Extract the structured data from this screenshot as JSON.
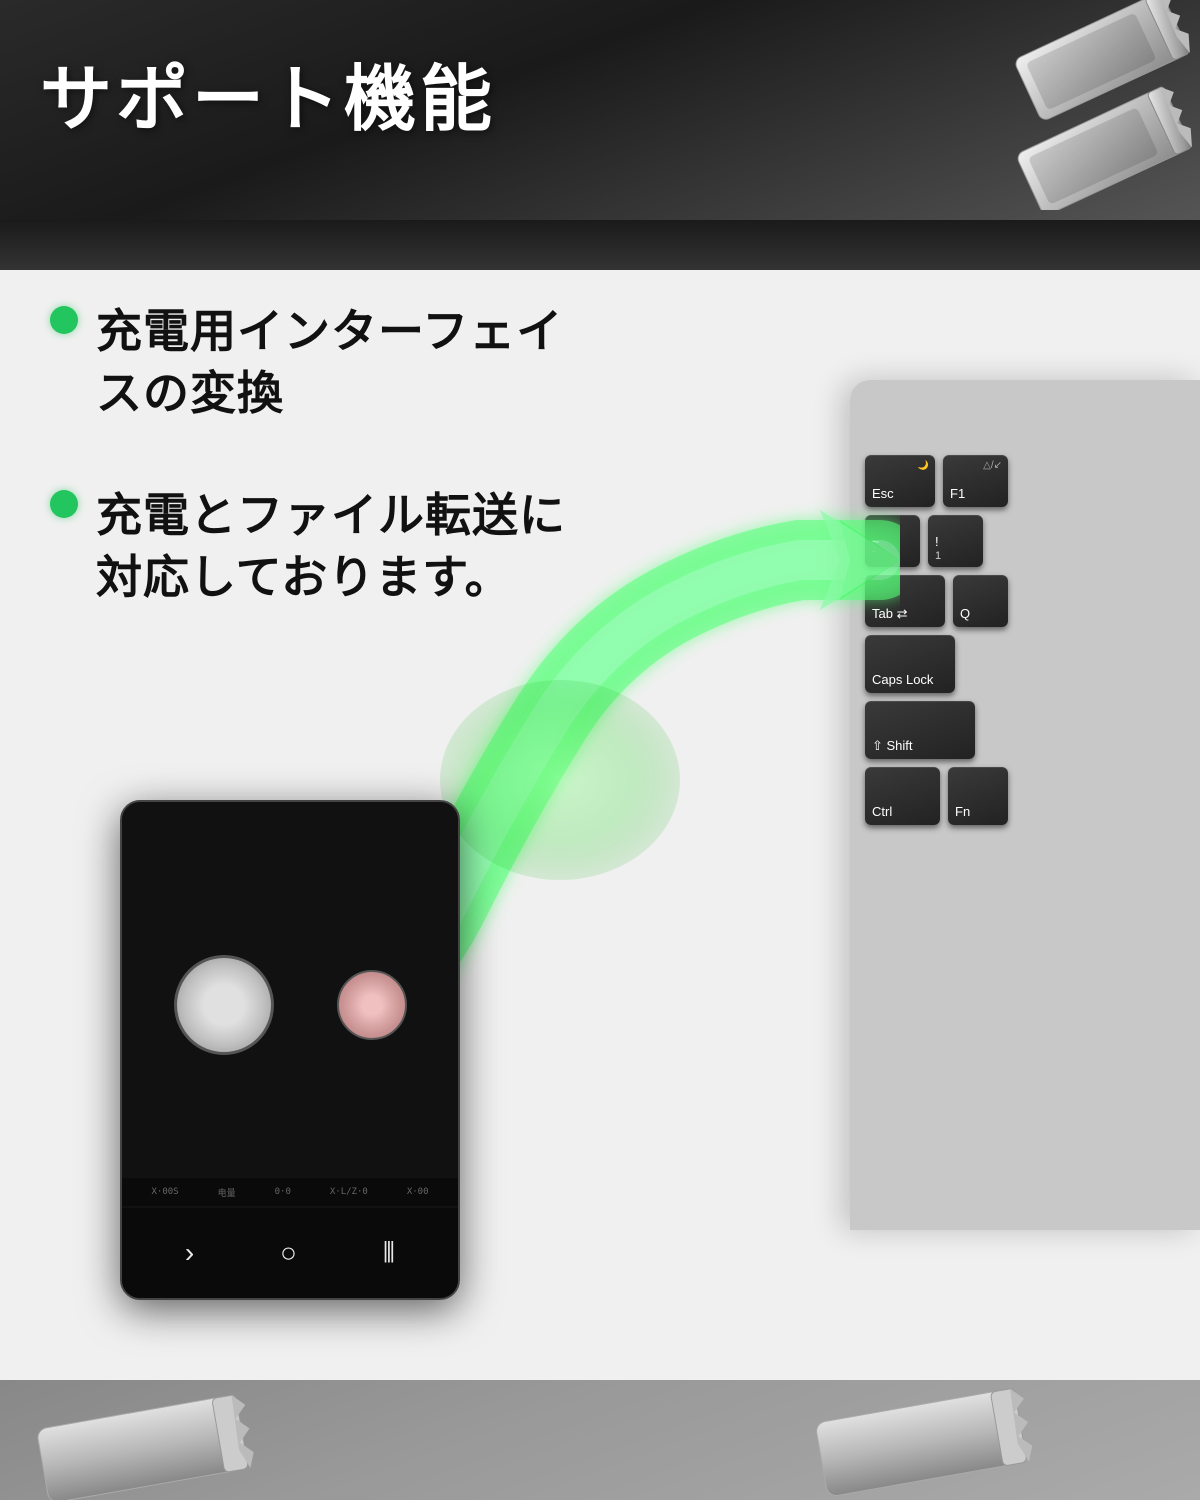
{
  "top": {
    "title": "サポート機能"
  },
  "features": [
    {
      "id": "feature-1",
      "text": "充電用インターフェイ\nスの変換"
    },
    {
      "id": "feature-2",
      "text": "充電とファイル転送に\n対応しております。"
    }
  ],
  "keyboard": {
    "rows": [
      [
        {
          "label": "Esc",
          "sub": "",
          "class": "key-esc"
        },
        {
          "label": "F1",
          "sub": "△/↙",
          "class": "key-f1"
        }
      ],
      [
        {
          "label": "~\n`",
          "sub": "",
          "class": "key-tilde"
        },
        {
          "label": "!\n1",
          "sub": "",
          "class": "key-1"
        }
      ],
      [
        {
          "label": "Tab ←→",
          "sub": "",
          "class": "key-tab"
        },
        {
          "label": "Q",
          "sub": "",
          "class": "key-q"
        }
      ],
      [
        {
          "label": "Caps\nLock",
          "sub": "",
          "class": "key-caps"
        }
      ],
      [
        {
          "label": "⇧ Shift",
          "sub": "",
          "class": "key-shift"
        }
      ],
      [
        {
          "label": "Ctrl",
          "sub": "",
          "class": "key-ctrl"
        },
        {
          "label": "Fn",
          "sub": "",
          "class": "key-fn"
        }
      ]
    ]
  },
  "phone": {
    "nav_icons": [
      ">",
      "O",
      "|||"
    ],
    "status_texts": [
      "X·00S",
      "电量",
      "0·0",
      "X·L/Z·0",
      "X·00"
    ]
  },
  "caps_lock_label": "Caps Lock"
}
